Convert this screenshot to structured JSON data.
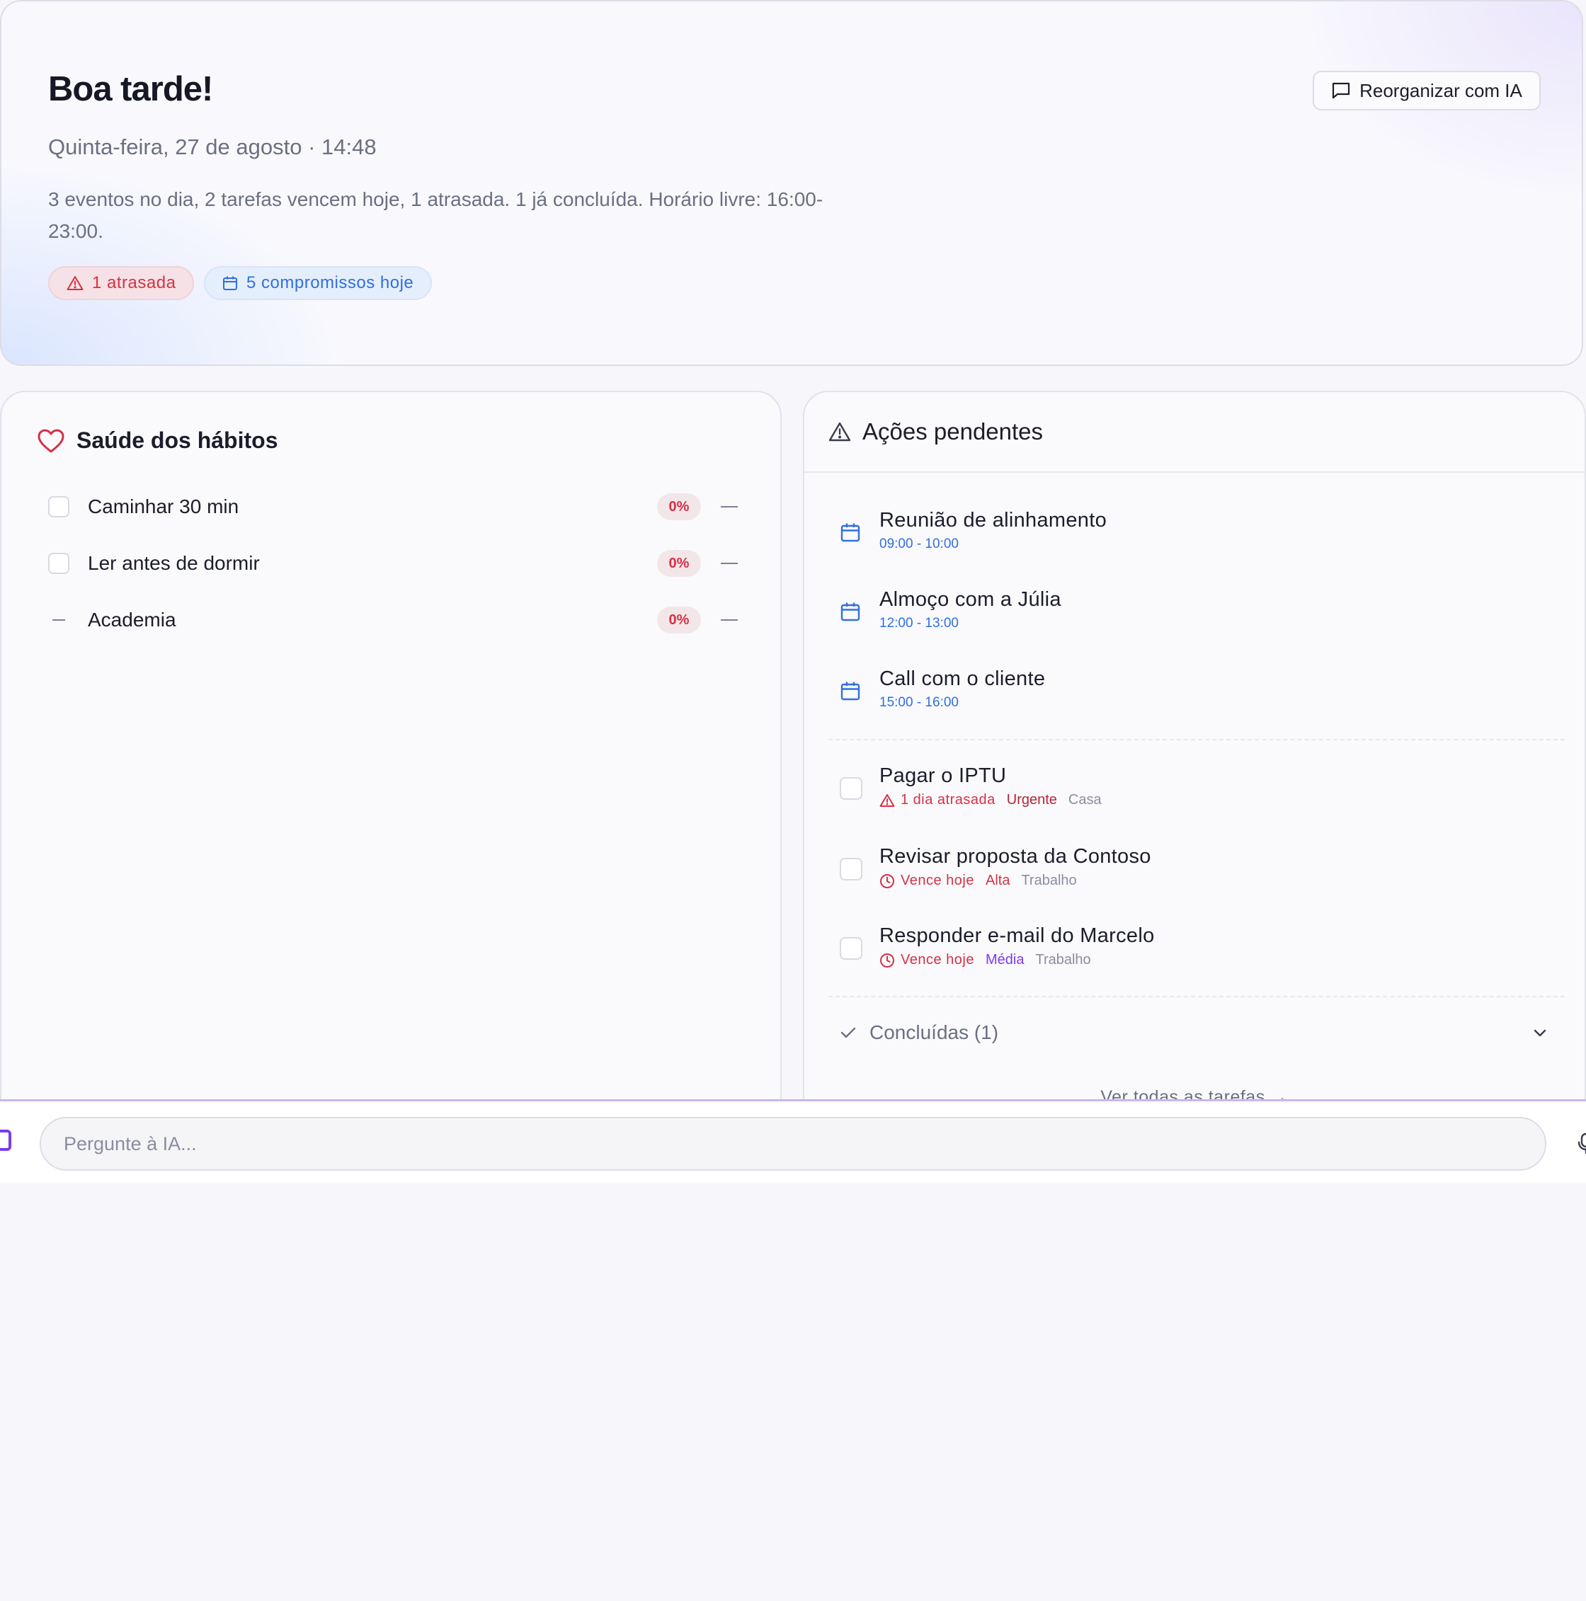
{
  "hero": {
    "greeting": "Boa tarde!",
    "date_time": "Quinta-feira, 27 de agosto · 14:48",
    "summary": "3 eventos no dia, 2 tarefas vencem hoje, 1 atrasada. 1 já concluída. Horário livre: 16:00-23:00.",
    "chip_overdue": "1 atrasada",
    "chip_events": "5 compromissos hoje",
    "reorganize_label": "Reorganizar com IA"
  },
  "habits": {
    "title": "Saúde dos hábitos",
    "items": [
      {
        "label": "Caminhar 30 min",
        "rate": "0%",
        "state": "unchecked"
      },
      {
        "label": "Ler antes de dormir",
        "rate": "0%",
        "state": "unchecked"
      },
      {
        "label": "Academia",
        "rate": "0%",
        "state": "skipped"
      }
    ]
  },
  "pending": {
    "title": "Ações pendentes",
    "events": [
      {
        "title": "Reunião de alinhamento",
        "time": "09:00 - 10:00"
      },
      {
        "title": "Almoço com a Júlia",
        "time": "12:00 - 13:00"
      },
      {
        "title": "Call com o cliente",
        "time": "15:00 - 16:00"
      }
    ],
    "tasks": [
      {
        "title": "Pagar o IPTU",
        "status": "1 dia atrasada",
        "status_icon": "alert-triangle-icon",
        "priority": "Urgente",
        "category": "Casa"
      },
      {
        "title": "Revisar proposta da Contoso",
        "status": "Vence hoje",
        "status_icon": "clock-icon",
        "priority": "Alta",
        "category": "Trabalho"
      },
      {
        "title": "Responder e-mail do Marcelo",
        "status": "Vence hoje",
        "status_icon": "clock-icon",
        "priority": "Média",
        "category": "Trabalho"
      }
    ],
    "completed_label": "Concluídas (1)",
    "see_all_label": "Ver todas as tarefas →"
  },
  "ai_bar": {
    "placeholder": "Pergunte à IA..."
  },
  "colors": {
    "accent_red": "#d63144",
    "accent_blue": "#2f6fe0",
    "accent_purple": "#7c3aed",
    "text_primary": "#1c1d2b",
    "text_muted": "#6b6f82"
  }
}
